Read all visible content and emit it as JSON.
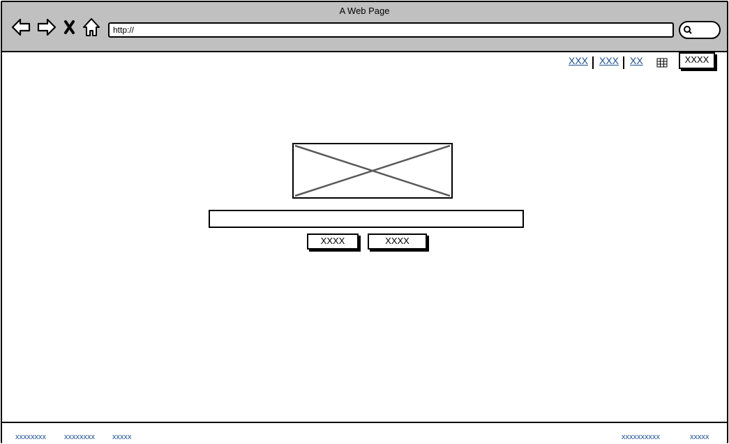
{
  "window": {
    "title": "A Web Page"
  },
  "browser": {
    "url": "http://",
    "icons": [
      "back-arrow-icon",
      "forward-arrow-icon",
      "close-icon",
      "home-icon",
      "search-icon"
    ]
  },
  "header": {
    "links": [
      "XXX",
      "XXX",
      "XX"
    ],
    "grid_icon": "grid-icon",
    "button_label": "XXXX"
  },
  "main": {
    "image_placeholder": "image-placeholder",
    "input_value": "",
    "buttons": [
      "XXXX",
      "XXXX"
    ]
  },
  "footer": {
    "left_links": [
      "xxxxxxxx",
      "xxxxxxxx",
      "xxxxx"
    ],
    "right_links": [
      "xxxxxxxxxx",
      "xxxxx"
    ]
  },
  "colors": {
    "titlebar_bg": "#c0c0c0",
    "link": "#1b4f8e",
    "border": "#000000",
    "placeholder_cross": "#5a5a5a"
  }
}
